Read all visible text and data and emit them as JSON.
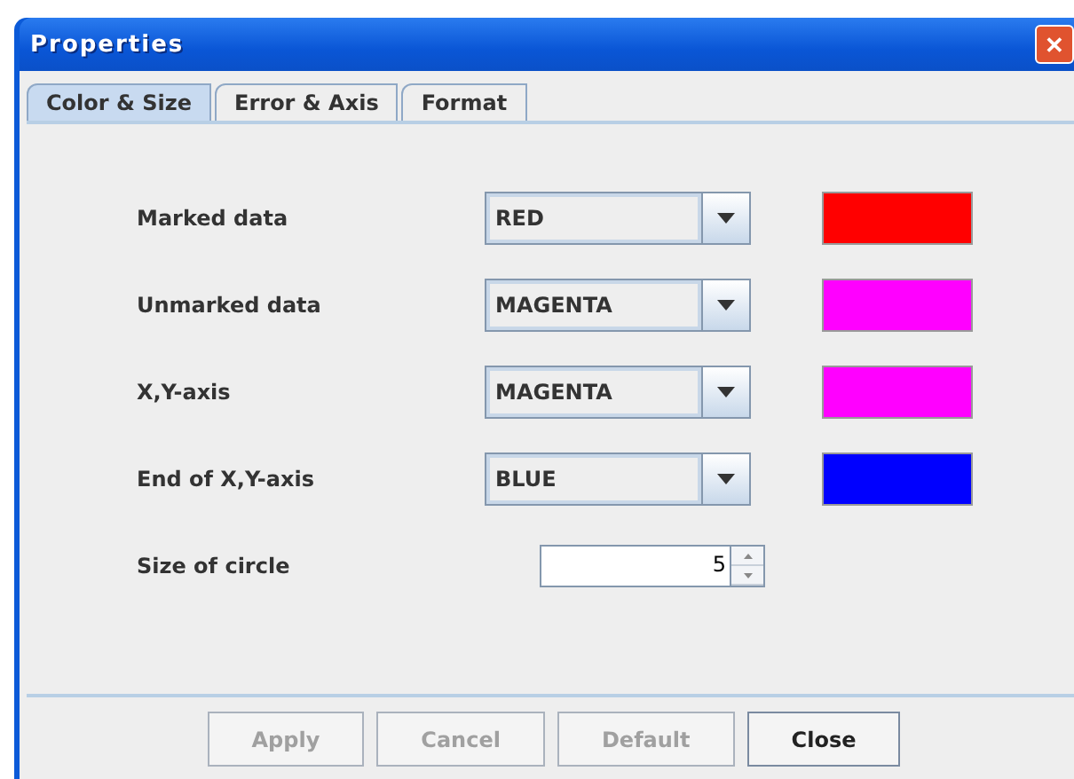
{
  "window": {
    "title": "Properties",
    "close_glyph": "✕"
  },
  "tabs": [
    {
      "label": "Color & Size",
      "selected": true
    },
    {
      "label": "Error & Axis",
      "selected": false
    },
    {
      "label": "Format",
      "selected": false
    }
  ],
  "rows": [
    {
      "label": "Marked data",
      "value": "RED",
      "color": "#ff0000"
    },
    {
      "label": "Unmarked data",
      "value": "MAGENTA",
      "color": "#ff00ff"
    },
    {
      "label": "X,Y-axis",
      "value": "MAGENTA",
      "color": "#ff00ff"
    },
    {
      "label": "End of X,Y-axis",
      "value": "BLUE",
      "color": "#0000ff"
    }
  ],
  "size": {
    "label": "Size of circle",
    "value": "5"
  },
  "buttons": [
    {
      "label": "Apply",
      "disabled": true
    },
    {
      "label": "Cancel",
      "disabled": true
    },
    {
      "label": "Default",
      "disabled": true
    },
    {
      "label": "Close",
      "disabled": false
    }
  ]
}
